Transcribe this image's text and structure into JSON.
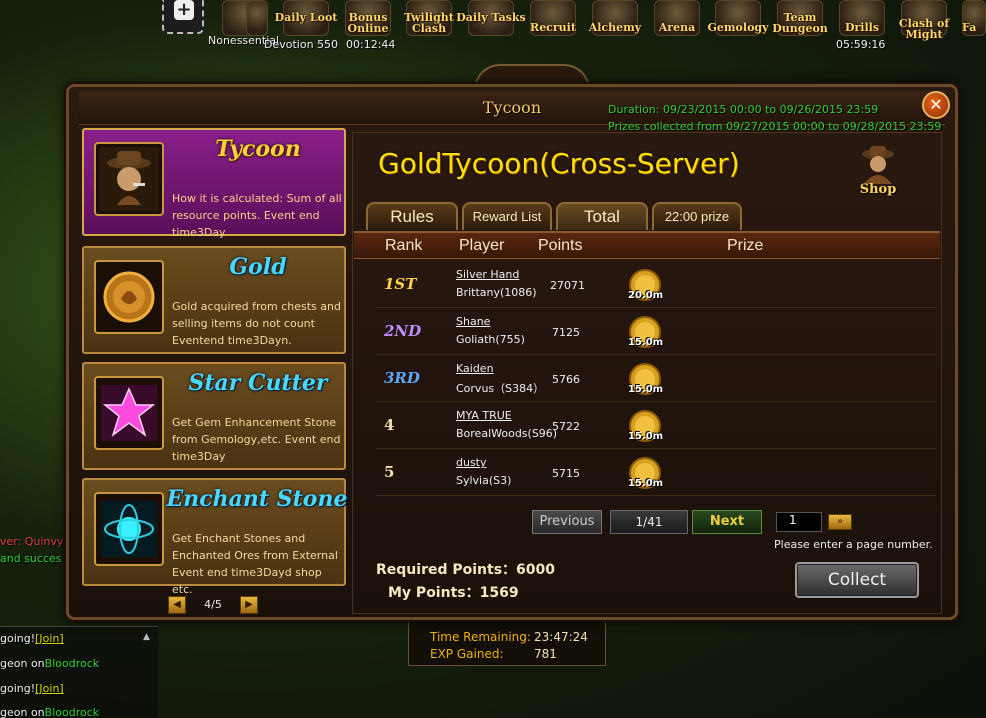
{
  "topbar": {
    "icons": [
      {
        "name": "nonessential-icon",
        "label": ""
      },
      {
        "name": "extra-icon",
        "label": ""
      },
      {
        "name": "daily-loot-icon",
        "label": "Daily Loot"
      },
      {
        "name": "bonus-online-icon",
        "label": "Bonus Online"
      },
      {
        "name": "twilight-clash-icon",
        "label": "Twilight Clash"
      },
      {
        "name": "daily-tasks-icon",
        "label": "Daily Tasks"
      },
      {
        "name": "recruit-icon",
        "label": "Recruit"
      },
      {
        "name": "alchemy-icon",
        "label": "Alchemy"
      },
      {
        "name": "arena-icon",
        "label": "Arena"
      },
      {
        "name": "gemology-icon",
        "label": "Gemology"
      },
      {
        "name": "team-dungeon-icon",
        "label": "Team Dungeon"
      },
      {
        "name": "drills-icon",
        "label": "Drills"
      },
      {
        "name": "clash-of-might-icon",
        "label": "Clash of Might"
      },
      {
        "name": "fa-icon",
        "label": "Fa"
      }
    ],
    "nonessential_label": "Nonessential",
    "devotion_label": "Devotion 550",
    "timer_left": "00:12:44",
    "timer_right": "05:59:16"
  },
  "background_chat": {
    "line1": "ver: Quinvy(",
    "line2": "and succes",
    "lines": [
      {
        "text": "going!",
        "link": "[Join]"
      },
      {
        "text": "geon on",
        "link": "Bloodrock"
      },
      {
        "text": "going!",
        "link": "[Join]"
      },
      {
        "text": "geon on",
        "link": "Bloodrock"
      }
    ]
  },
  "status_box": {
    "time_label": "Time Remaining:",
    "time_value": "23:47:24",
    "exp_label": "EXP Gained:",
    "exp_value": "781"
  },
  "modal": {
    "title": "Tycoon",
    "duration": "Duration: 09/23/2015 00:00 to 09/26/2015 23:59",
    "prizes_collected": "Prizes collected from 09/27/2015 00:00 to 09/28/2015 23:59"
  },
  "events": [
    {
      "name": "Tycoon",
      "desc": "How it is calculated: Sum of all resource points. Event end time3Day",
      "icon": "tycoon-icon"
    },
    {
      "name": "Gold",
      "desc": "Gold acquired from chests and selling items do not count Eventend time3Dayn.",
      "icon": "gold-icon"
    },
    {
      "name": "Star Cutter",
      "desc": "Get Gem Enhancement Stone from Gemology,etc. Event end time3Day",
      "icon": "star-cutter-icon"
    },
    {
      "name": "Enchant Stone",
      "desc": "Get Enchant Stones and Enchanted Ores from External Event end time3Dayd shop etc.",
      "icon": "enchant-stone-icon"
    }
  ],
  "event_pager": {
    "text": "4/5"
  },
  "main": {
    "title": "GoldTycoon(Cross-Server)",
    "shop_label": "Shop",
    "tabs": [
      "Rules",
      "Reward List",
      "Total",
      "22:00 prize"
    ],
    "headers": {
      "rank": "Rank",
      "player": "Player",
      "points": "Points",
      "prize": "Prize"
    },
    "rows": [
      {
        "rank": "1ST",
        "name": "Silver Hand",
        "server": "Brittany(1086)",
        "points": "27071",
        "prize": "20.0m"
      },
      {
        "rank": "2ND",
        "name": "Shane",
        "server": "Goliath(755)",
        "points": "7125",
        "prize": "15.0m"
      },
      {
        "rank": "3RD",
        "name": "Kaiden",
        "server": "Corvus（S384）",
        "points": "5766",
        "prize": "15.0m"
      },
      {
        "rank": "4",
        "name": "MYA TRUE",
        "server": "BorealWoods(S96)",
        "points": "5722",
        "prize": "15.0m"
      },
      {
        "rank": "5",
        "name": "dusty",
        "server": "Sylvia(S3)",
        "points": "5715",
        "prize": "15.0m"
      }
    ],
    "pagination": {
      "previous": "Previous",
      "page": "1/41",
      "next": "Next",
      "input_value": "1",
      "hint": "Please enter a page number."
    },
    "required_points_label": "Required Points：",
    "required_points_value": "6000",
    "my_points_label": "My Points：",
    "my_points_value": "1569",
    "collect_label": "Collect"
  },
  "colors": {
    "rank1": "#ffd24a",
    "rank2": "#c08cff",
    "rank3": "#5aa8ff",
    "rank_other": "#f0e0b0",
    "duration_green": "#33cc33",
    "title_yellow": "#ffe000"
  }
}
